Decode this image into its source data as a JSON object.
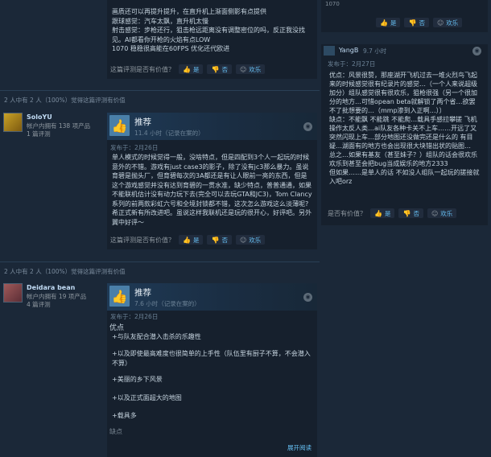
{
  "reviews": [
    {
      "text": "画质还可以再提升提升，在直升机上渐面侧影有点提供\n跟球感觉：汽车太飘，直升机太慢\n射击感觉：步枪还行，狙击枪远距离没有调整密位的吗，反正我没找见。AI都看你开枪的火焰有点LOW\n1070 稳稳很高能在60FPS 优化还代欧进",
      "helpful_question": "这篇评测是否有价值？",
      "vote_yes": "是",
      "vote_no": "否",
      "vote_funny": "欢乐"
    },
    {
      "found_helpful": "2 人中有 2 人（100%）觉得这篇评测有价值",
      "author_name": "SoloYU",
      "author_products": "帐户内拥有 138 项产品",
      "author_reviews": "1 篇评测",
      "verdict": "推荐",
      "hours": "11.4 小时（记录在案的）",
      "posted": "发布于：2月26日",
      "text": "单人模式的时候觉得一般，没啥特点，但是四配到3个人一起玩的时候意外的不错。游戏有just case3的影子，除了没有jc3那么暴力。虽说育碧是抛头厂，但育碧每次的3A都还是有让人眼前一亮的东西，但是这个游戏感觉并没有达到育碧的一贯水准，缺少特点，普普通通，如果不能联机估计没有动力玩下去(完全可以去玩GTA和JC3)，Tom Clancy系列的前两款彩虹六号和全境封锁都不错，这次怎么游戏这么淡薄呢? 希正式新有所改进吧。虽说这样我联机还是玩的很开心，好评吧。另外翼中好评～",
      "helpful_question": "这篇评测是否有价值？",
      "vote_yes": "是",
      "vote_no": "否",
      "vote_funny": "欢乐"
    },
    {
      "found_helpful": "2 人中有 2 人（100%）觉得这篇评测有价值",
      "author_name": "Deidara bean",
      "author_products": "帐户内拥有 19 项产品",
      "author_reviews": "4 篇评测",
      "verdict": "推荐",
      "hours": "7.6 小时（记录在案的）",
      "posted": "发布于：2月26日",
      "section_pros": "优点",
      "pros": [
        "+与队友配合潜入击杀的乐趣性",
        "+以及即使最高难度也很简单的上手性（队伍里有厨子不算，不会潜入不算）",
        "+美丽的乡下风景",
        "+以及正式面超大的地图",
        "+载具多"
      ],
      "section_cons": "缺点",
      "read_more": "展开阅读"
    }
  ],
  "right_reviews": [
    {
      "vote_yes": "是",
      "vote_no": "否",
      "vote_funny": "欢乐",
      "top_text": "1070"
    },
    {
      "author_name": "YangB",
      "hours": "9.7 小时",
      "posted": "发布于：2月27日",
      "text": "优点：风景很赞，那座湖开飞机过去一堆火烈鸟飞起来的时候感觉很有纪录片的感觉…（一个人来说超级加分）组队感觉很有很欢乐，狙枪很强（另一个很加分的地方…可惜opean beta就解锁了两个省…欲罢不了批想要的…（mmp渗到入正啊…））\n缺点：不能飘 不能跳 不能爬…载具手感拉攀搓 飞机操作太反人类…ai队友各种卡关不上车……开远了又突然闪现上车…部分地图还没做完还是什么的 有目疑…湖面有的地方也会出现很大块错出状的贴图…\n总之…如果有基友（甚至妹子？）组队的话会很欢乐 欢乐到甚至会把bug当成娱乐的地方2333\n但如果……是单人的话 不如没人组队一起玩的搓接就入吧orz",
      "helpful_question": "是否有价值？",
      "vote_yes": "是",
      "vote_no": "否",
      "vote_funny": "欢乐"
    }
  ],
  "icons": {
    "thumb_up": "thumbs-up-icon",
    "steam": "steam-icon",
    "vote_yes": "thumbs-up-small-icon",
    "vote_no": "thumbs-down-small-icon",
    "vote_funny": "smiley-icon"
  },
  "colors": {
    "background": "#1b2838",
    "card": "#16202d",
    "accent": "#66c0f4",
    "thumb": "#4a7fa8"
  }
}
